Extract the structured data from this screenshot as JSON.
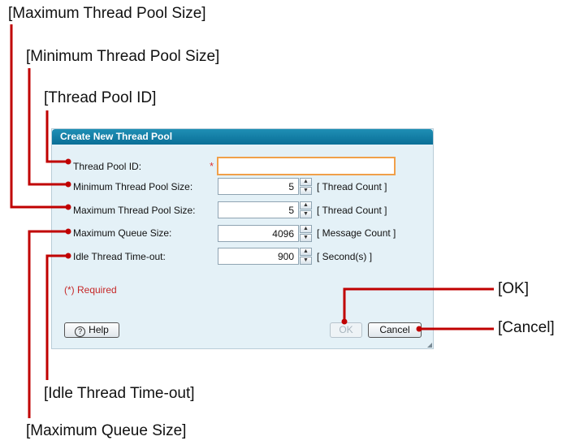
{
  "callouts": {
    "max_pool": "[Maximum Thread Pool Size]",
    "min_pool": "[Minimum Thread Pool Size]",
    "pool_id": "[Thread Pool ID]",
    "ok": "[OK]",
    "cancel": "[Cancel]",
    "idle": "[Idle Thread Time-out]",
    "queue": "[Maximum Queue Size]"
  },
  "dialog": {
    "title": "Create New Thread Pool",
    "required_mark": "*",
    "required_note": "(*) Required",
    "fields": {
      "pool_id": {
        "label": "Thread Pool ID:",
        "value": ""
      },
      "min_pool": {
        "label": "Minimum Thread Pool Size:",
        "value": "5",
        "unit": "[ Thread Count ]"
      },
      "max_pool": {
        "label": "Maximum Thread Pool Size:",
        "value": "5",
        "unit": "[ Thread Count ]"
      },
      "queue": {
        "label": "Maximum Queue Size:",
        "value": "4096",
        "unit": "[ Message Count ]"
      },
      "idle": {
        "label": "Idle Thread Time-out:",
        "value": "900",
        "unit": "[ Second(s) ]"
      }
    },
    "buttons": {
      "help": "Help",
      "help_glyph": "?",
      "ok": "OK",
      "cancel": "Cancel"
    }
  },
  "colors": {
    "leader_line": "#c00000",
    "titlebar": "#0f78a0",
    "dialog_bg": "#e4f1f7",
    "focus_border": "#f0a04a",
    "required_text": "#c62828"
  }
}
